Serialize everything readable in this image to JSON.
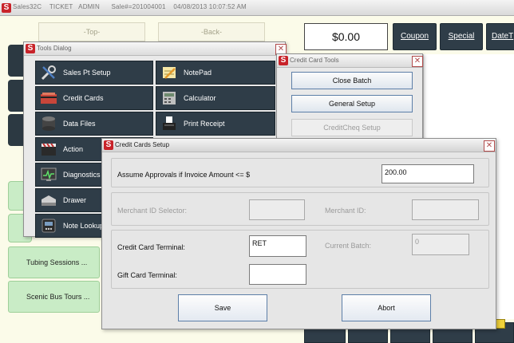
{
  "app": {
    "title": "Sales32C    TICKET   ADMIN      Sale#=201004001    04/08/2013 10:07:52 AM"
  },
  "pos": {
    "top_label": "-Top-",
    "back_label": "-Back-",
    "total": "$0.00",
    "coupon_label": "Coupon",
    "special_label": "Special",
    "datetime_label": "DateT",
    "items": [
      "Tubing Sessions ...",
      "Scenic Bus Tours ..."
    ]
  },
  "tools_dialog": {
    "title": "Tools Dialog",
    "buttons": [
      {
        "label": "Sales Pt Setup",
        "icon": "wrench-screwdriver-icon"
      },
      {
        "label": "NotePad",
        "icon": "notepad-pencil-icon"
      },
      {
        "label": "Credit Cards",
        "icon": "credit-cards-icon"
      },
      {
        "label": "Calculator",
        "icon": "calculator-icon"
      },
      {
        "label": "Data Files",
        "icon": "database-files-icon"
      },
      {
        "label": "Print Receipt",
        "icon": "receipt-printer-icon"
      },
      {
        "label": "Action",
        "icon": "clapperboard-icon"
      },
      {
        "label": "Diagnostics",
        "icon": "diagnostics-monitor-icon"
      },
      {
        "label": "Drawer",
        "icon": "cash-drawer-icon"
      },
      {
        "label": "Note Lookup",
        "icon": "phone-notes-icon"
      }
    ]
  },
  "cc_tools": {
    "title": "Credit Card Tools",
    "close_batch_label": "Close Batch",
    "general_setup_label": "General Setup",
    "creditcheq_label": "CreditCheq Setup"
  },
  "cc_setup": {
    "title": "Credit Cards Setup",
    "assume_label": "Assume Approvals if Invoice Amount <= $",
    "assume_value": "200.00",
    "merchant_id_selector_label": "Merchant ID Selector:",
    "merchant_id_label": "Merchant ID:",
    "terminal_label": "Credit Card Terminal:",
    "terminal_value": "RET",
    "current_batch_label": "Current Batch:",
    "current_batch_value": "0",
    "gift_card_label": "Gift Card Terminal:",
    "gift_card_value": "",
    "save_label": "Save",
    "abort_label": "Abort"
  },
  "colors": {
    "dark_button": "#2f3d48",
    "green_button": "#c9ecc6",
    "brand_red": "#c8232a",
    "accent_blue_border": "#5d7fa8"
  }
}
